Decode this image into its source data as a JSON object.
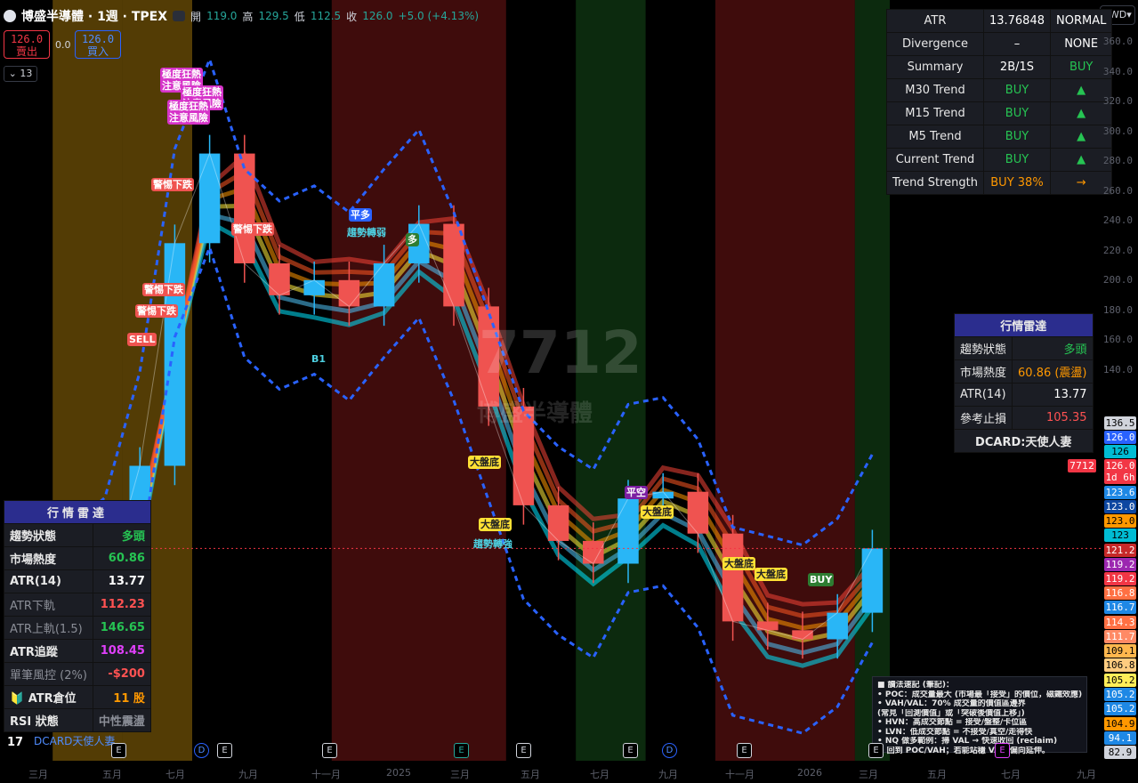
{
  "header": {
    "title": "博盛半導體 · 1週 · TPEX",
    "open_label": "開",
    "open": "119.0",
    "high_label": "高",
    "high": "129.5",
    "low_label": "低",
    "low": "112.5",
    "close_label": "收",
    "close": "126.0",
    "change": "+5.0 (+4.13%)"
  },
  "trade": {
    "sell_price": "126.0",
    "sell_label": "賣出",
    "spread": "0.0",
    "buy_price": "126.0",
    "buy_label": "買入"
  },
  "indicator_count": "13",
  "currency": "TWD",
  "watermark": {
    "symbol": "7712",
    "name": "博盛半導體"
  },
  "atr_table": {
    "rows": [
      {
        "label": "ATR",
        "value": "13.76848",
        "status": "NORMAL",
        "value_color": "white",
        "status_color": "white"
      },
      {
        "label": "Divergence",
        "value": "–",
        "status": "NONE",
        "value_color": "white",
        "status_color": "white"
      },
      {
        "label": "Summary",
        "value": "2B/1S",
        "status": "BUY",
        "value_color": "white",
        "status_color": "green"
      },
      {
        "label": "M30 Trend",
        "value": "BUY",
        "status": "▲",
        "value_color": "green",
        "status_color": "green"
      },
      {
        "label": "M15 Trend",
        "value": "BUY",
        "status": "▲",
        "value_color": "green",
        "status_color": "green"
      },
      {
        "label": "M5 Trend",
        "value": "BUY",
        "status": "▲",
        "value_color": "green",
        "status_color": "green"
      },
      {
        "label": "Current Trend",
        "value": "BUY",
        "status": "▲",
        "value_color": "green",
        "status_color": "green"
      },
      {
        "label": "Trend Strength",
        "value": "BUY 38%",
        "status": "→",
        "value_color": "orange",
        "status_color": "orange"
      }
    ]
  },
  "market_radar_right": {
    "title": "行情雷達",
    "rows": [
      {
        "label": "趨勢狀態",
        "value": "多頭",
        "color": "green"
      },
      {
        "label": "市場熱度",
        "value": "60.86 (震盪)",
        "color": "orange"
      },
      {
        "label": "ATR(14)",
        "value": "13.77",
        "color": "white"
      },
      {
        "label": "參考止損",
        "value": "105.35",
        "color": "red"
      }
    ],
    "footer": "DCARD:天使人妻"
  },
  "market_radar_left": {
    "title": "行情雷達",
    "rows": [
      {
        "label": "趨勢狀態",
        "value": "多頭",
        "color": "green",
        "dim": false
      },
      {
        "label": "市場熱度",
        "value": "60.86",
        "color": "green",
        "dim": false
      },
      {
        "label": "ATR(14)",
        "value": "13.77",
        "color": "white",
        "dim": false
      },
      {
        "label": "ATR下軌",
        "value": "112.23",
        "color": "red",
        "dim": true
      },
      {
        "label": "ATR上軌(1.5)",
        "value": "146.65",
        "color": "green",
        "dim": true
      },
      {
        "label": "ATR追蹤",
        "value": "108.45",
        "color": "magenta",
        "dim": false
      },
      {
        "label": "單筆風控 (2%)",
        "value": "-$200",
        "color": "red",
        "dim": true
      },
      {
        "label": "🔰 ATR倉位",
        "value": "11 股",
        "color": "orange",
        "dim": false
      },
      {
        "label": "RSI 狀態",
        "value": "中性震盪",
        "color": "gray",
        "dim": false
      }
    ],
    "footer": "DCARD天使人妻"
  },
  "notes": {
    "lines": [
      "■ 讀法速記 (筆記)：",
      "• POC：成交量最大 (市場最「接受」的價位，磁鐵效應)",
      "• VAH/VAL：70% 成交量的價值區邊界",
      "  (常見「回測價值」或「突破後價值上移」)",
      "• HVN：高成交節點 = 接受/盤整/卡位區",
      "• LVN：低成交節點 = 不接受/真空/走得快",
      "• NQ 做多範例：掃 VAL → 快速收回 (reclaim)",
      "  → 回到 POC/VAH；若能站穩 VAH 偏向延伸。"
    ]
  },
  "price_axis": {
    "ticks": [
      "360.0",
      "340.0",
      "320.0",
      "300.0",
      "280.0",
      "260.0",
      "240.0",
      "220.0",
      "200.0",
      "180.0",
      "160.0",
      "140.0"
    ],
    "labels": [
      {
        "text": "136.5",
        "bg": "#d1d4dc",
        "fg": "#000"
      },
      {
        "text": "126.0",
        "bg": "#2962ff",
        "fg": "#fff"
      },
      {
        "text": "126",
        "bg": "#00bcd4",
        "fg": "#000"
      },
      {
        "text": "126.0",
        "bg": "#f23645",
        "fg": "#fff"
      },
      {
        "text": "1d 6h",
        "bg": "#f23645",
        "fg": "#fff"
      },
      {
        "text": "123.6",
        "bg": "#1e88e5",
        "fg": "#fff"
      },
      {
        "text": "123.0",
        "bg": "#0d47a1",
        "fg": "#fff"
      },
      {
        "text": "123.0",
        "bg": "#ff9800",
        "fg": "#000"
      },
      {
        "text": "123",
        "bg": "#00bcd4",
        "fg": "#000"
      },
      {
        "text": "121.2",
        "bg": "#c62828",
        "fg": "#fff"
      },
      {
        "text": "119.2",
        "bg": "#9c27b0",
        "fg": "#fff"
      },
      {
        "text": "119.2",
        "bg": "#f23645",
        "fg": "#fff"
      },
      {
        "text": "116.8",
        "bg": "#ff7043",
        "fg": "#fff"
      },
      {
        "text": "116.7",
        "bg": "#1e88e5",
        "fg": "#fff"
      },
      {
        "text": "114.3",
        "bg": "#ff7043",
        "fg": "#fff"
      },
      {
        "text": "111.7",
        "bg": "#ff8a65",
        "fg": "#fff"
      },
      {
        "text": "109.1",
        "bg": "#ffb74d",
        "fg": "#000"
      },
      {
        "text": "106.8",
        "bg": "#ffcc80",
        "fg": "#000"
      },
      {
        "text": "105.2",
        "bg": "#ffee58",
        "fg": "#000"
      },
      {
        "text": "105.2",
        "bg": "#1e88e5",
        "fg": "#fff"
      },
      {
        "text": "105.2",
        "bg": "#1e88e5",
        "fg": "#fff"
      },
      {
        "text": "104.9",
        "bg": "#ff9800",
        "fg": "#000"
      },
      {
        "text": "94.1",
        "bg": "#1e88e5",
        "fg": "#fff"
      },
      {
        "text": "82.9",
        "bg": "#d1d4dc",
        "fg": "#000"
      }
    ],
    "symbol_tag": "7712"
  },
  "time_axis": {
    "ticks": [
      "三月",
      "五月",
      "七月",
      "九月",
      "十一月",
      "2025",
      "三月",
      "五月",
      "七月",
      "九月",
      "十一月",
      "2026",
      "三月",
      "五月",
      "七月",
      "九月"
    ]
  },
  "event_markers": [
    {
      "type": "E"
    },
    {
      "type": "D"
    },
    {
      "type": "E"
    },
    {
      "type": "E"
    },
    {
      "type": "E"
    },
    {
      "type": "E"
    },
    {
      "type": "E"
    },
    {
      "type": "D"
    },
    {
      "type": "E"
    },
    {
      "type": "E"
    },
    {
      "type": "E"
    }
  ],
  "signals": [
    {
      "text": "極度狂熱\n注意風險",
      "style": "pink"
    },
    {
      "text": "極度狂熱\n注意風險",
      "style": "pink"
    },
    {
      "text": "極度狂熱\n注意風險",
      "style": "pink"
    },
    {
      "text": "警惕下跌",
      "style": "red"
    },
    {
      "text": "警惕下跌",
      "style": "red"
    },
    {
      "text": "警惕下跌",
      "style": "red"
    },
    {
      "text": "警惕下跌",
      "style": "red"
    },
    {
      "text": "SELL",
      "style": "red"
    },
    {
      "text": "平多",
      "style": "blue"
    },
    {
      "text": "趨勢轉弱",
      "style": "cyan"
    },
    {
      "text": "多",
      "style": "green"
    },
    {
      "text": "B1",
      "style": "cyan"
    },
    {
      "text": "大盤底",
      "style": "yellow"
    },
    {
      "text": "大盤底",
      "style": "yellow"
    },
    {
      "text": "趨勢轉強",
      "style": "cyan"
    },
    {
      "text": "平空",
      "style": "purple"
    },
    {
      "text": "大盤底",
      "style": "yellow"
    },
    {
      "text": "大盤底",
      "style": "yellow"
    },
    {
      "text": "大盤底",
      "style": "yellow"
    },
    {
      "text": "BUY",
      "style": "green"
    }
  ],
  "chart_data": {
    "type": "candlestick",
    "title": "博盛半導體 · 1週 · TPEX",
    "ylim": [
      82,
      372
    ],
    "y_scale": "log",
    "periods": [
      "2024-02",
      "2024-03",
      "2024-04",
      "2024-05",
      "2024-06",
      "2024-07",
      "2024-08",
      "2024-09",
      "2024-10",
      "2024-11",
      "2024-12",
      "2025-01",
      "2025-02",
      "2025-03",
      "2025-04",
      "2025-05",
      "2025-06",
      "2025-07",
      "2025-08",
      "2025-09",
      "2025-10",
      "2025-11",
      "2025-12",
      "2026-01",
      "2026-02"
    ],
    "close": [
      112,
      108,
      115,
      150,
      240,
      290,
      230,
      215,
      222,
      210,
      230,
      250,
      210,
      170,
      138,
      128,
      122,
      140,
      142,
      130,
      108,
      106,
      104,
      110,
      126
    ],
    "ema_bands": {
      "colors": [
        "#00e5ff",
        "#4fc3f7",
        "#ffeb3b",
        "#ff9800",
        "#ff5722",
        "#f44336"
      ]
    },
    "background_zones": [
      {
        "from": "2024-03",
        "to": "2024-04",
        "color": "#b8860b"
      },
      {
        "from": "2024-05",
        "to": "2024-06",
        "color": "#b8860b"
      },
      {
        "from": "2024-11",
        "to": "2025-03",
        "color": "#8b1a1a"
      },
      {
        "from": "2025-06",
        "to": "2025-07",
        "color": "#1b5e20"
      },
      {
        "from": "2025-10",
        "to": "2026-01",
        "color": "#8b1a1a"
      },
      {
        "from": "2026-02",
        "to": "2026-02",
        "color": "#1b5e20"
      }
    ]
  }
}
